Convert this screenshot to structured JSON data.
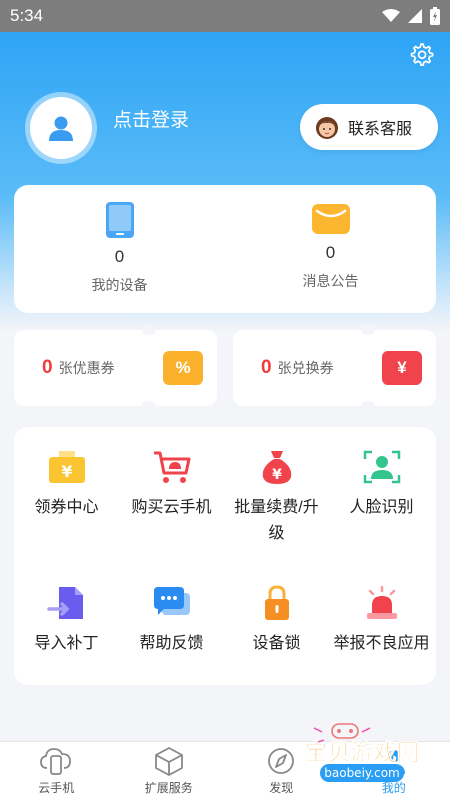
{
  "status_bar": {
    "time": "5:34"
  },
  "profile": {
    "login_text": "点击登录",
    "contact_label": "联系客服"
  },
  "stats": [
    {
      "count": "0",
      "label": "我的设备"
    },
    {
      "count": "0",
      "label": "消息公告"
    }
  ],
  "coupons": [
    {
      "count": "0",
      "label": "张优惠券",
      "symbol": "%"
    },
    {
      "count": "0",
      "label": "张兑换券",
      "symbol": "¥"
    }
  ],
  "grid": [
    {
      "label": "领券中心"
    },
    {
      "label": "购买云手机"
    },
    {
      "label": "批量续费/升级"
    },
    {
      "label": "人脸识别"
    },
    {
      "label": "导入补丁"
    },
    {
      "label": "帮助反馈"
    },
    {
      "label": "设备锁"
    },
    {
      "label": "举报不良应用"
    }
  ],
  "tabs": [
    {
      "label": "云手机"
    },
    {
      "label": "扩展服务"
    },
    {
      "label": "发现"
    },
    {
      "label": "我的"
    }
  ],
  "watermark": {
    "title": "宝贝游戏网",
    "url": "baobeiy.com"
  },
  "colors": {
    "accent": "#2a9df4",
    "coupon_red": "#f03c3c",
    "coupon_orange": "#fbb02b"
  }
}
